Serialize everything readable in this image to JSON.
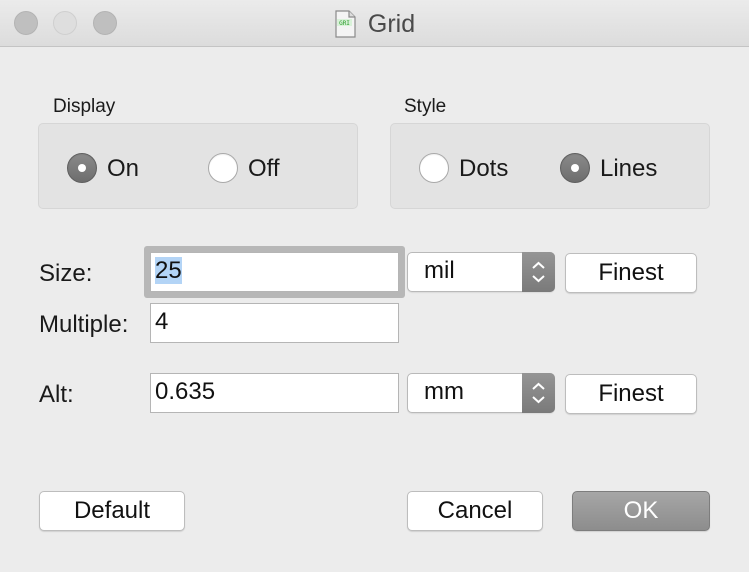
{
  "window": {
    "title": "Grid",
    "title_icon": "grid-document-icon"
  },
  "display": {
    "label": "Display",
    "options": [
      {
        "label": "On",
        "checked": true
      },
      {
        "label": "Off",
        "checked": false
      }
    ]
  },
  "style": {
    "label": "Style",
    "options": [
      {
        "label": "Dots",
        "checked": false
      },
      {
        "label": "Lines",
        "checked": true
      }
    ]
  },
  "size": {
    "label": "Size:",
    "value": "25",
    "unit": "mil",
    "finest_label": "Finest"
  },
  "multiple": {
    "label": "Multiple:",
    "value": "4"
  },
  "alt": {
    "label": "Alt:",
    "value": "0.635",
    "unit": "mm",
    "finest_label": "Finest"
  },
  "buttons": {
    "default": "Default",
    "cancel": "Cancel",
    "ok": "OK"
  },
  "colors": {
    "window_bg": "#ececec",
    "group_bg": "#e3e3e3",
    "selection": "#b3d4f6",
    "default_button": "#999999"
  }
}
